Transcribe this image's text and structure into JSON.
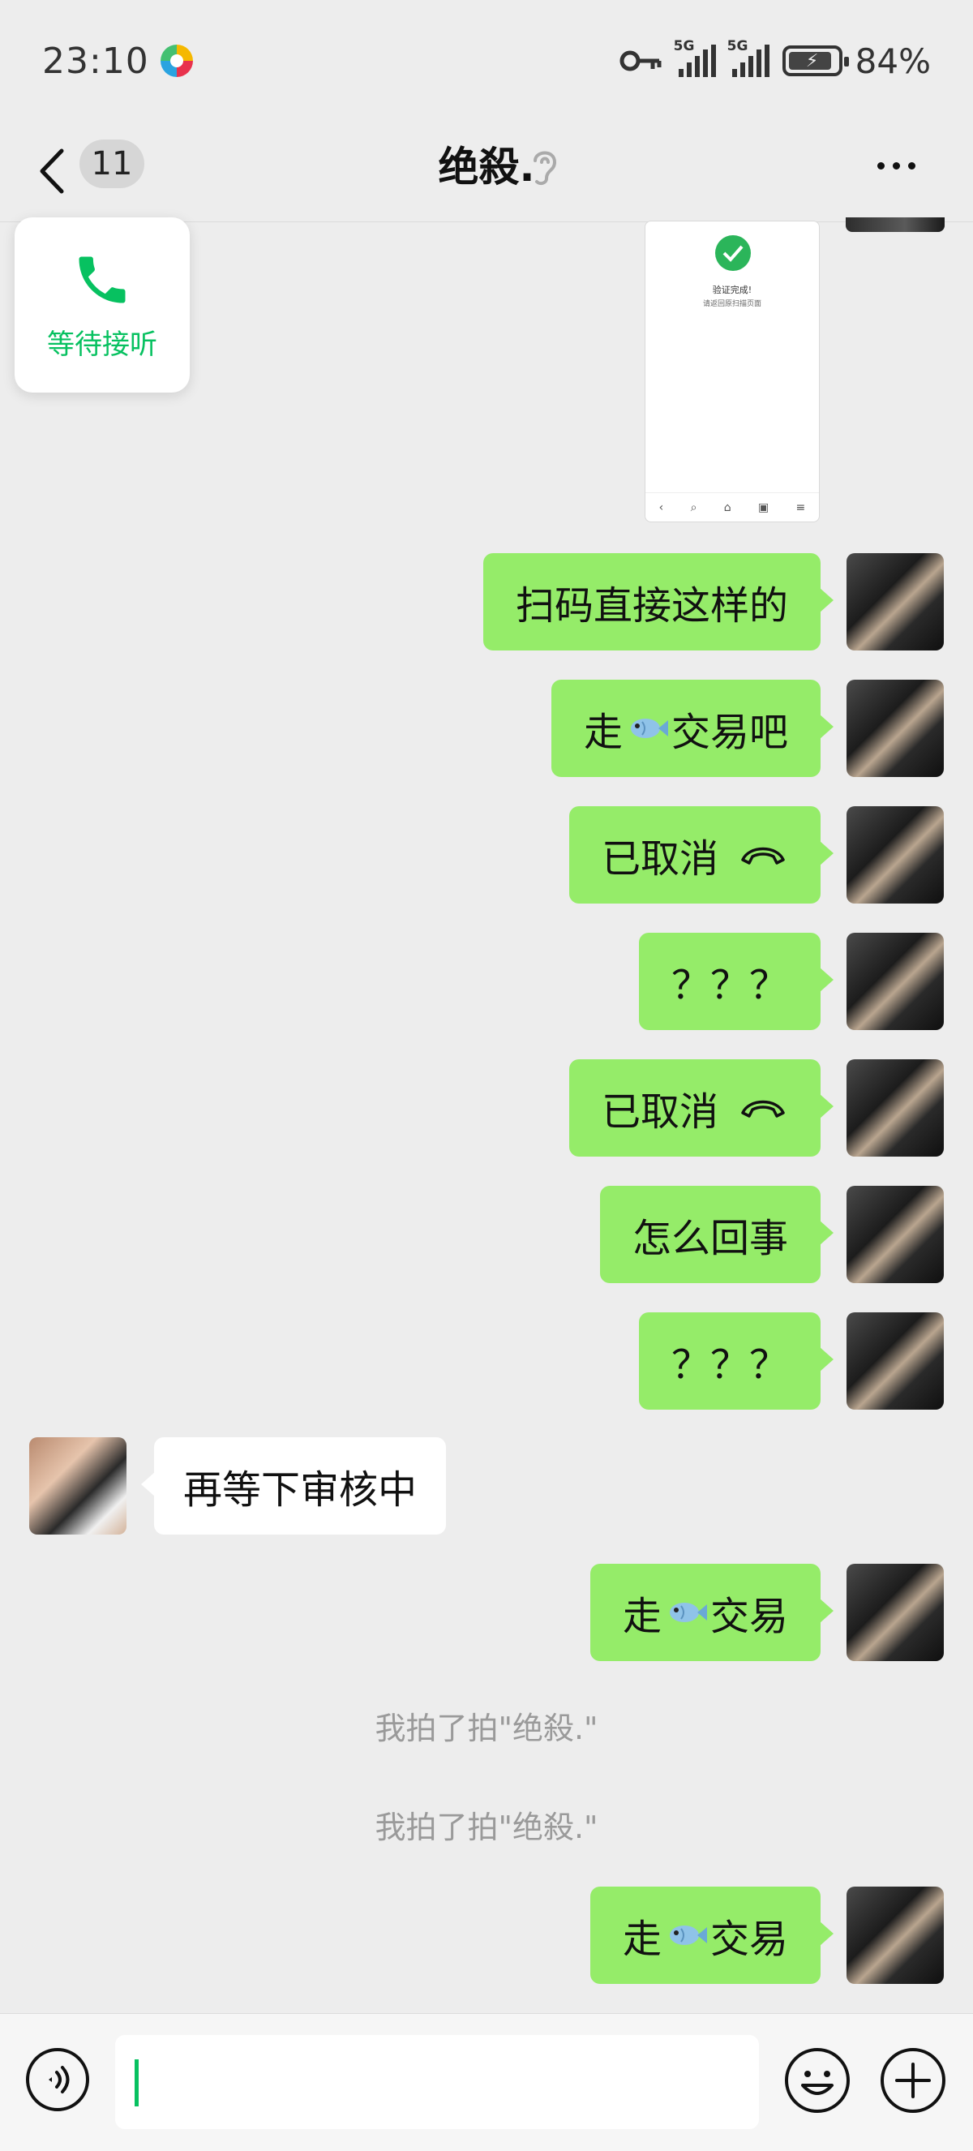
{
  "status_bar": {
    "time": "23:10",
    "signal1_label": "5G",
    "signal2_label": "5G",
    "battery_percent": "84%",
    "icons": [
      "app-icon",
      "key-icon",
      "signal-icon",
      "battery-charging-icon"
    ]
  },
  "nav": {
    "unread_count": "11",
    "title": "绝殺."
  },
  "call_card": {
    "label": "等待接听",
    "icon": "phone-icon"
  },
  "image_message": {
    "line1": "验证完成!",
    "line2": "请返回原扫描页面",
    "nav_glyphs": [
      "‹",
      "⌕",
      "⌂",
      "▣",
      "≡"
    ]
  },
  "messages": [
    {
      "dir": "out",
      "text": "扫码直接这样的"
    },
    {
      "dir": "out",
      "parts": [
        "走",
        "交易吧"
      ],
      "emoji": "fish"
    },
    {
      "dir": "out",
      "text": "已取消",
      "icon": "hang-up-icon"
    },
    {
      "dir": "out",
      "text": "？？？"
    },
    {
      "dir": "out",
      "text": "已取消",
      "icon": "hang-up-icon"
    },
    {
      "dir": "out",
      "text": "怎么回事"
    },
    {
      "dir": "out",
      "text": "？？？"
    },
    {
      "dir": "in",
      "text": "再等下审核中"
    },
    {
      "dir": "out",
      "parts": [
        "走",
        "交易"
      ],
      "emoji": "fish"
    },
    {
      "dir": "system",
      "text": "我拍了拍\"绝殺.\""
    },
    {
      "dir": "system",
      "text": "我拍了拍\"绝殺.\""
    },
    {
      "dir": "out",
      "parts": [
        "走",
        "交易"
      ],
      "emoji": "fish"
    }
  ],
  "input_bar": {
    "value": "",
    "icons": [
      "voice-icon",
      "emoji-icon",
      "plus-icon"
    ]
  },
  "colors": {
    "accent": "#07c160",
    "bubble_out": "#95ec69",
    "bubble_in": "#ffffff",
    "background": "#ededed"
  }
}
